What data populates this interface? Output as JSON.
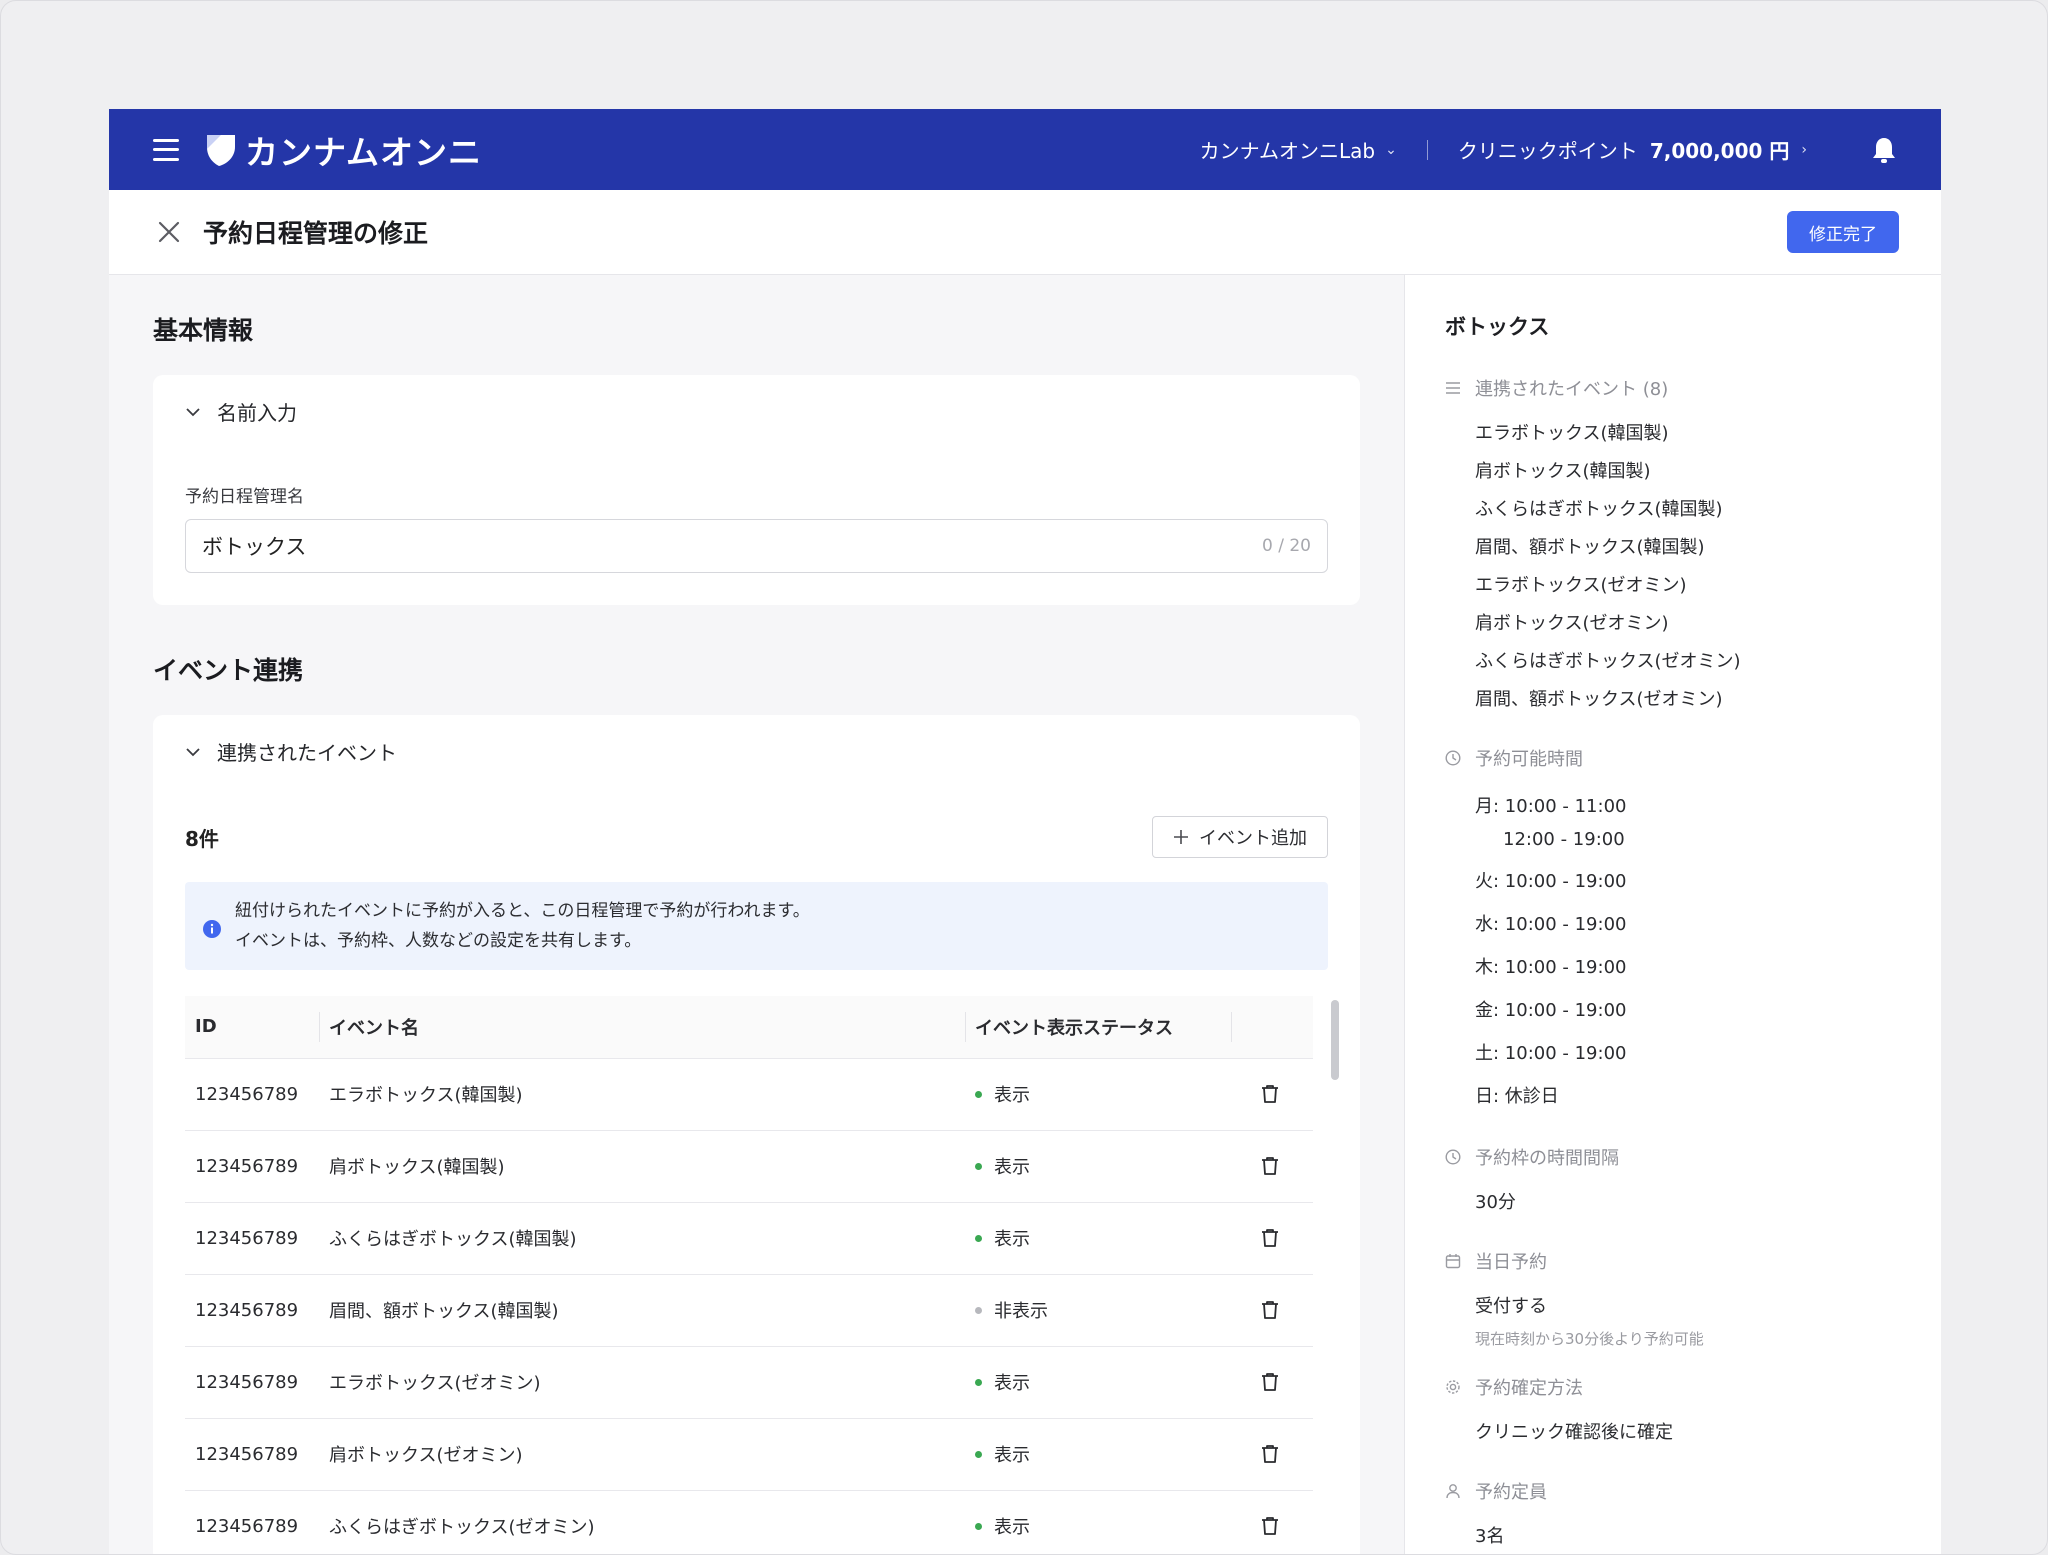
{
  "header": {
    "logo_text": "カンナムオンニ",
    "clinic_name": "カンナムオンニLab",
    "points_label": "クリニックポイント",
    "points_value": "7,000,000 円"
  },
  "titlebar": {
    "title": "予約日程管理の修正",
    "complete_button": "修正完了"
  },
  "basic": {
    "section_title": "基本情報",
    "card_title": "名前入力",
    "field_label": "予約日程管理名",
    "field_value": "ボトックス",
    "field_counter": "0 / 20"
  },
  "events": {
    "section_title": "イベント連携",
    "card_title": "連携されたイベント",
    "count": "8件",
    "add_button": "イベント追加",
    "info_line1": "紐付けられたイベントに予約が入ると、この日程管理で予約が行われます。",
    "info_line2": "イベントは、予約枠、人数などの設定を共有します。",
    "columns": {
      "id": "ID",
      "name": "イベント名",
      "status": "イベント表示ステータス"
    },
    "rows": [
      {
        "id": "123456789",
        "name": "エラボトックス(韓国製)",
        "status": "表示"
      },
      {
        "id": "123456789",
        "name": "肩ボトックス(韓国製)",
        "status": "表示"
      },
      {
        "id": "123456789",
        "name": "ふくらはぎボトックス(韓国製)",
        "status": "表示"
      },
      {
        "id": "123456789",
        "name": "眉間、額ボトックス(韓国製)",
        "status": "非表示"
      },
      {
        "id": "123456789",
        "name": "エラボトックス(ゼオミン)",
        "status": "表示"
      },
      {
        "id": "123456789",
        "name": "肩ボトックス(ゼオミン)",
        "status": "表示"
      },
      {
        "id": "123456789",
        "name": "ふくらはぎボトックス(ゼオミン)",
        "status": "表示"
      }
    ],
    "status_colors": {
      "表示": "#3aa852",
      "非表示": "#b7b8bd"
    }
  },
  "side": {
    "title": "ボトックス",
    "linked_heading": "連携されたイベント (8)",
    "linked_events": [
      "エラボトックス(韓国製)",
      "肩ボトックス(韓国製)",
      "ふくらはぎボトックス(韓国製)",
      "眉間、額ボトックス(韓国製)",
      "エラボトックス(ゼオミン)",
      "肩ボトックス(ゼオミン)",
      "ふくらはぎボトックス(ゼオミン)",
      "眉間、額ボトックス(ゼオミン)"
    ],
    "hours_heading": "予約可能時間",
    "hours": {
      "mon": "月: 10:00 - 11:00",
      "mon2": "12:00 - 19:00",
      "tue": "火: 10:00 - 19:00",
      "wed": "水: 10:00 - 19:00",
      "thu": "木: 10:00 - 19:00",
      "fri": "金: 10:00 - 19:00",
      "sat": "土: 10:00 - 19:00",
      "sun": "日: 休診日"
    },
    "interval_heading": "予約枠の時間間隔",
    "interval_value": "30分",
    "sameday_heading": "当日予約",
    "sameday_value": "受付する",
    "sameday_note": "現在時刻から30分後より予約可能",
    "confirm_heading": "予約確定方法",
    "confirm_value": "クリニック確認後に確定",
    "capacity_heading": "予約定員",
    "capacity_value": "3名"
  },
  "colors": {
    "brand": "#2436a8",
    "primary_button": "#4167ee",
    "info_bg": "#eef3fd"
  }
}
